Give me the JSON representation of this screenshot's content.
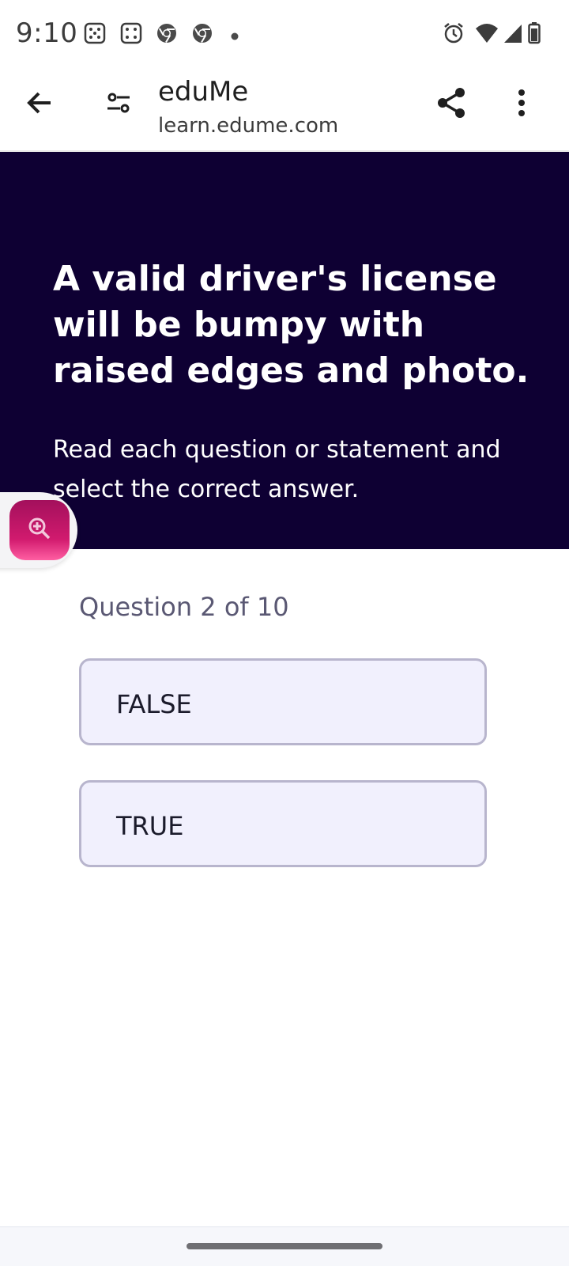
{
  "status_bar": {
    "time": "9:10",
    "notification_icons": [
      "dice-icon",
      "dice-icon",
      "chrome-icon",
      "chrome-icon",
      "dot-icon"
    ],
    "system_icons": [
      "alarm-icon",
      "wifi-icon",
      "signal-icon",
      "battery-icon"
    ]
  },
  "toolbar": {
    "back_icon": "arrow-left-icon",
    "site_settings_icon": "tune-icon",
    "site_title": "eduMe",
    "site_url": "learn.edume.com",
    "share_icon": "share-icon",
    "menu_icon": "more-vert-icon"
  },
  "hero": {
    "title": "A valid driver's license will be bumpy with raised edges and photo.",
    "subtitle": "Read each question or statement and select the correct answer."
  },
  "zoom_button": {
    "icon": "zoom-in-icon"
  },
  "quiz": {
    "counter": "Question 2 of 10",
    "current_question": 2,
    "total_questions": 10,
    "options": [
      {
        "label": "FALSE"
      },
      {
        "label": "TRUE"
      }
    ]
  },
  "colors": {
    "hero_background": "#0e0033",
    "option_background": "#f1f0fd",
    "option_border": "#b8b5cd",
    "fab_accent": "#d11a6e",
    "counter_text": "#5a5873"
  }
}
